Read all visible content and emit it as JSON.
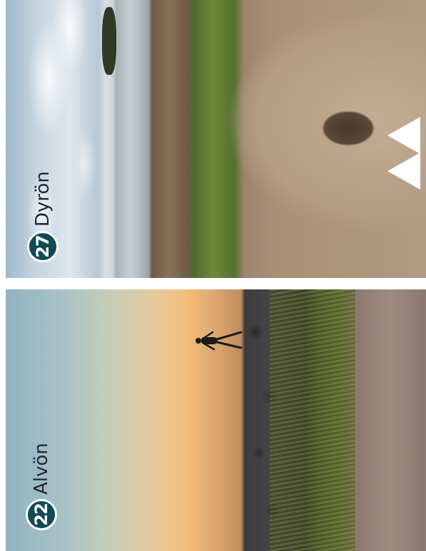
{
  "panels": [
    {
      "number": "27",
      "name": "Dyrön"
    },
    {
      "number": "22",
      "name": "Alvön"
    }
  ]
}
